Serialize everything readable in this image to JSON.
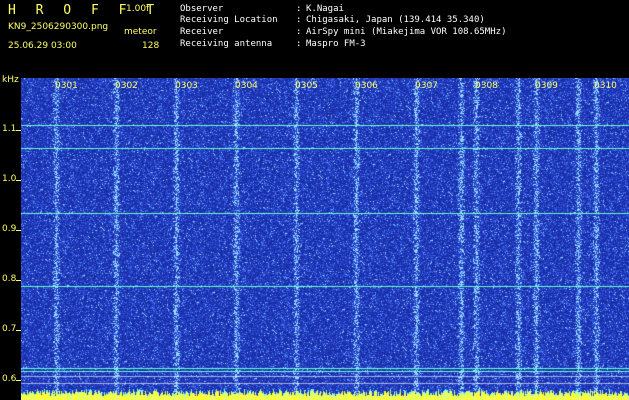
{
  "header": {
    "app_title": "H R O F F T",
    "version": "1.00f",
    "file_name": "KN9_2506290300.png",
    "mode": "meteor",
    "datetime": "25.06.29 03:00",
    "fft_size": "128"
  },
  "station_info": [
    {
      "label": "Observer",
      "value": "K.Nagai"
    },
    {
      "label": "Receiving Location",
      "value": "Chigasaki, Japan (139.414 35.340)"
    },
    {
      "label": "Receiver",
      "value": "AirSpy mini (Miakejima VOR 108.65MHz)"
    },
    {
      "label": "Receiving antenna",
      "value": "Maspro FM-3"
    }
  ],
  "plot": {
    "y_unit": "kHz",
    "y_ticks": [
      "1.1",
      "1.0",
      "0.9",
      "0.8",
      "0.7",
      "0.6"
    ],
    "time_labels": [
      "0301",
      "0302",
      "0303",
      "0304",
      "0305",
      "0306",
      "0307",
      "0308",
      "0309",
      "0310"
    ],
    "colors": {
      "background": "#1a2ea8",
      "noise": "#3f6cff",
      "bright_noise": "#88ccff",
      "signal_line": "#66ffcc",
      "bottom_band": "#ffff33",
      "labels": "#ffff66"
    }
  }
}
